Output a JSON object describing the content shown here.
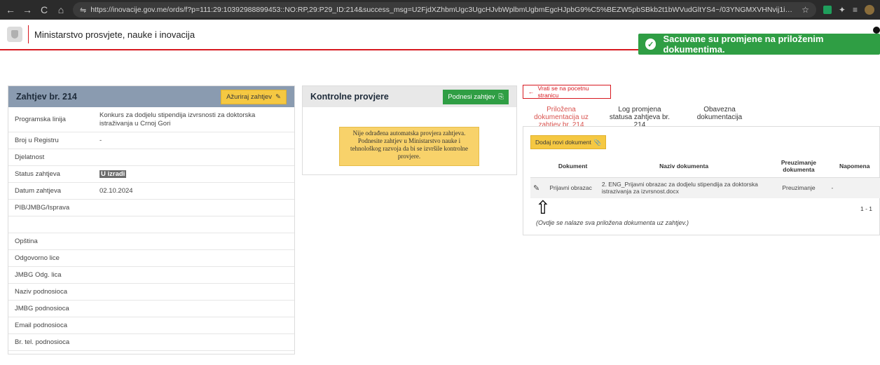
{
  "browser": {
    "back": "←",
    "forward": "→",
    "reload": "C",
    "home": "⌂",
    "url": "https://inovacije.gov.me/ords/f?p=111:29:10392988899453::NO:RP,29:P29_ID:214&success_msg=U2FjdXZhbmUgc3UgcHJvbWplbmUgbmEgcHJpbG9%C5%BEZW5pbSBkb2t1bWVudGltYS4~/03YNGMXVHNvij1iQ08gQBDQKXhVf3WcXGWFW-NRu...",
    "star": "☆"
  },
  "header": {
    "title": "Ministarstvo prosvjete, nauke i inovacija"
  },
  "toast": {
    "message": "Sacuvane su promjene na priloženim dokumentima.",
    "check": "✓"
  },
  "zahtjev": {
    "title": "Zahtjev br. 214",
    "update_btn": "Ažuriraj zahtjev",
    "rows": [
      {
        "label": "Programska linija",
        "value": "Konkurs za dodjelu stipendija izvrsnosti za doktorska istraživanja u Crnoj Gori"
      },
      {
        "label": "Broj u Registru",
        "value": "-"
      },
      {
        "label": "Djelatnost",
        "value": ""
      },
      {
        "label": "Status zahtjeva",
        "value": "U izradi"
      },
      {
        "label": "Datum zahtjeva",
        "value": "02.10.2024"
      },
      {
        "label": "PIB/JMBG/Isprava",
        "value": ""
      },
      {
        "label": "",
        "value": ""
      },
      {
        "label": "Opština",
        "value": ""
      },
      {
        "label": "Odgovorno lice",
        "value": ""
      },
      {
        "label": "JMBG Odg. lica",
        "value": ""
      },
      {
        "label": "Naziv podnosioca",
        "value": ""
      },
      {
        "label": "JMBG podnosioca",
        "value": ""
      },
      {
        "label": "Email podnosioca",
        "value": ""
      },
      {
        "label": "Br. tel. podnosioca",
        "value": ""
      }
    ]
  },
  "kontrolne": {
    "title": "Kontrolne provjere",
    "submit_btn": "Podnesi zahtjev",
    "notice": "Nije odrađena automatska provjera zahtjeva. Podnesite zahtjev u Ministarstvo nauke i tehnološkog razvoja da bi se izvršile kontrolne provjere."
  },
  "docs": {
    "back_btn": "Vrati se na pocetnu stranicu",
    "tabs": [
      {
        "label": "Priložena dokumentacija uz zahtjev br. 214"
      },
      {
        "label": "Log promjena statusa zahtjeva br. 214"
      },
      {
        "label": "Obavezna dokumentacija"
      }
    ],
    "add_btn": "Dodaj novi dokument",
    "columns": [
      "",
      "Dokument",
      "Naziv dokumenta",
      "Preuzimanje dokumenta",
      "Napomena"
    ],
    "rows": [
      {
        "dokument": "Prijavni obrazac",
        "naziv": "2. ENG_Prijavni obrazac za dodjelu stipendija za doktorska istrazivanja za izvrsnost.docx",
        "preuzimanje": "Preuzimanje",
        "napomena": "-"
      }
    ],
    "pager": "1 - 1",
    "note": "(Ovdje se nalaze sva priložena dokumenta uz zahtjev.)"
  }
}
